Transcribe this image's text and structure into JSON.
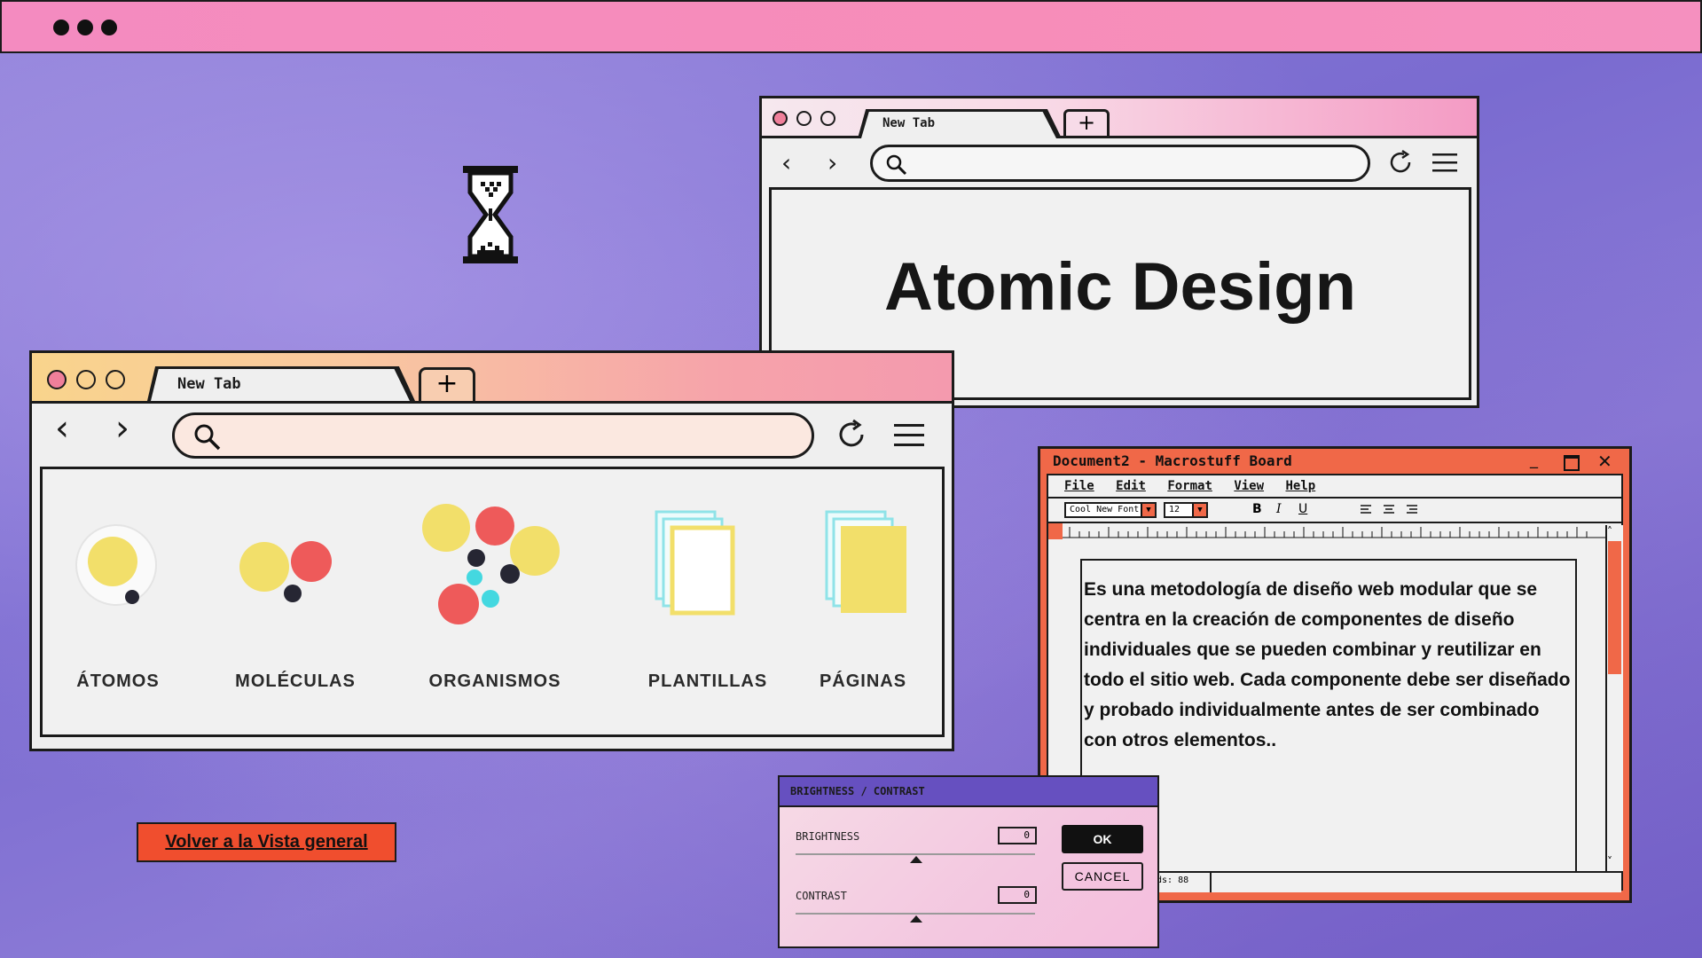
{
  "browser_back": {
    "tab_label": "New Tab",
    "heading": "Atomic Design"
  },
  "browser_front": {
    "tab_label": "New Tab",
    "items": [
      {
        "label": "ÁTOMOS"
      },
      {
        "label": "MOLÉCULAS"
      },
      {
        "label": "ORGANISMOS"
      },
      {
        "label": "PLANTILLAS"
      },
      {
        "label": "PÁGINAS"
      }
    ]
  },
  "document": {
    "title": "Document2 - Macrostuff Board",
    "menu": [
      "File",
      "Edit",
      "Format",
      "View",
      "Help"
    ],
    "font": "Cool New Font",
    "size": "12",
    "bold": "B",
    "italic": "I",
    "underline": "U",
    "body": "Es una metodología de diseño web modular que se centra en la creación de componentes de diseño individuales que se pueden combinar y reutilizar en todo el sitio web. Cada componente debe ser diseñado y probado individualmente antes de ser combinado con otros elementos..",
    "status": "ds: 88"
  },
  "dialog": {
    "title": "BRIGHTNESS / CONTRAST",
    "brightness_label": "BRIGHTNESS",
    "brightness_value": "0",
    "contrast_label": "CONTRAST",
    "contrast_value": "0",
    "ok": "OK",
    "cancel": "CANCEL"
  },
  "back_link": "Volver a la Vista general",
  "colors": {
    "pink": "#f48bc0",
    "orange_red": "#f04e2e",
    "yellow": "#f2df6a",
    "red": "#ee5a5a",
    "cyan": "#44d8e0",
    "purple": "#6650c0"
  }
}
